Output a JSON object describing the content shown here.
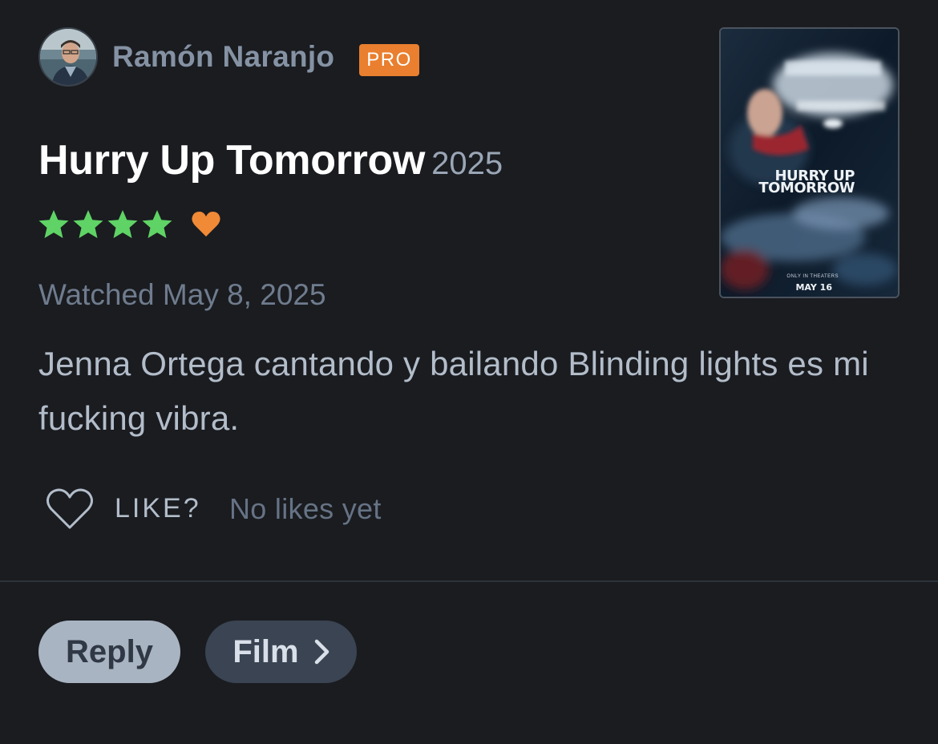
{
  "review": {
    "author": {
      "name": "Ramón Naranjo",
      "badge": "PRO",
      "badge_color": "#e97f2f",
      "avatar": "user-avatar-photo"
    },
    "film": {
      "title": "Hurry Up Tomorrow",
      "year": "2025",
      "poster": {
        "title_line1": "HURRY UP",
        "title_line2": "TOMORROW",
        "small_text": "ONLY IN THEATERS",
        "release_text": "MAY 16"
      }
    },
    "rating": {
      "stars": 4,
      "max_stars": 5,
      "star_color": "#5fd365",
      "liked": true,
      "heart_color": "#f08a36"
    },
    "watched_text": "Watched May 8, 2025",
    "body": "Jenna Ortega cantando y bailando Blinding lights es mi fucking vibra.",
    "like": {
      "label": "LIKE?",
      "count_text": "No likes yet"
    }
  },
  "actions": {
    "reply_label": "Reply",
    "film_label": "Film"
  },
  "icons": [
    "star-icon",
    "heart-icon",
    "heart-outline-icon",
    "chevron-right-icon"
  ]
}
